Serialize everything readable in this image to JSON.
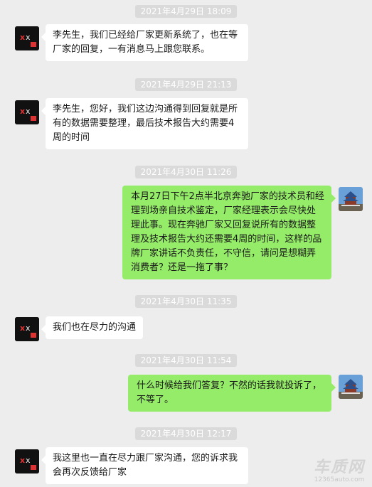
{
  "messages": [
    {
      "kind": "time",
      "text": "2021年4月29日 18:09"
    },
    {
      "kind": "msg",
      "side": "left",
      "text": "李先生，我们已经给厂家更新系统了，也在等厂家的回复，一有消息马上跟您联系。"
    },
    {
      "kind": "time",
      "text": "2021年4月29日 21:13"
    },
    {
      "kind": "msg",
      "side": "left",
      "text": "李先生，您好，我们这边沟通得到回复就是所有的数据需要整理，最后技术报告大约需要4周的时间"
    },
    {
      "kind": "time",
      "text": "2021年4月30日 11:26"
    },
    {
      "kind": "msg",
      "side": "right",
      "text": "本月27日下午2点半北京奔驰厂家的技术员和经理到场亲自技术鉴定，厂家经理表示会尽快处理此事。现在奔驰厂家又回复说所有的数据整理及技术报告大约还需要4周的时间，这样的品牌厂家讲话不负责任，不守信，请问是想糊弄消费者？还是一拖了事？"
    },
    {
      "kind": "time",
      "text": "2021年4月30日 11:35"
    },
    {
      "kind": "msg",
      "side": "left",
      "text": "我们也在尽力的沟通"
    },
    {
      "kind": "time",
      "text": "2021年4月30日 11:54"
    },
    {
      "kind": "msg",
      "side": "right",
      "text": "什么时候给我们答复？不然的话我就投诉了，不等了。"
    },
    {
      "kind": "time",
      "text": "2021年4月30日 12:17"
    },
    {
      "kind": "msg",
      "side": "left",
      "text": "我这里也一直在尽力跟厂家沟通，您的诉求我会再次反馈给厂家"
    }
  ],
  "watermark": {
    "main": "车质网",
    "sub": "12365auto.com"
  },
  "colors": {
    "background": "#ededed",
    "bubble_self": "#95ec69",
    "bubble_other": "#ffffff",
    "timestamp_bg": "#dadada"
  },
  "icons": {
    "dealer_avatar": "dealer-avatar-icon",
    "user_avatar": "temple-of-heaven-avatar-icon"
  }
}
